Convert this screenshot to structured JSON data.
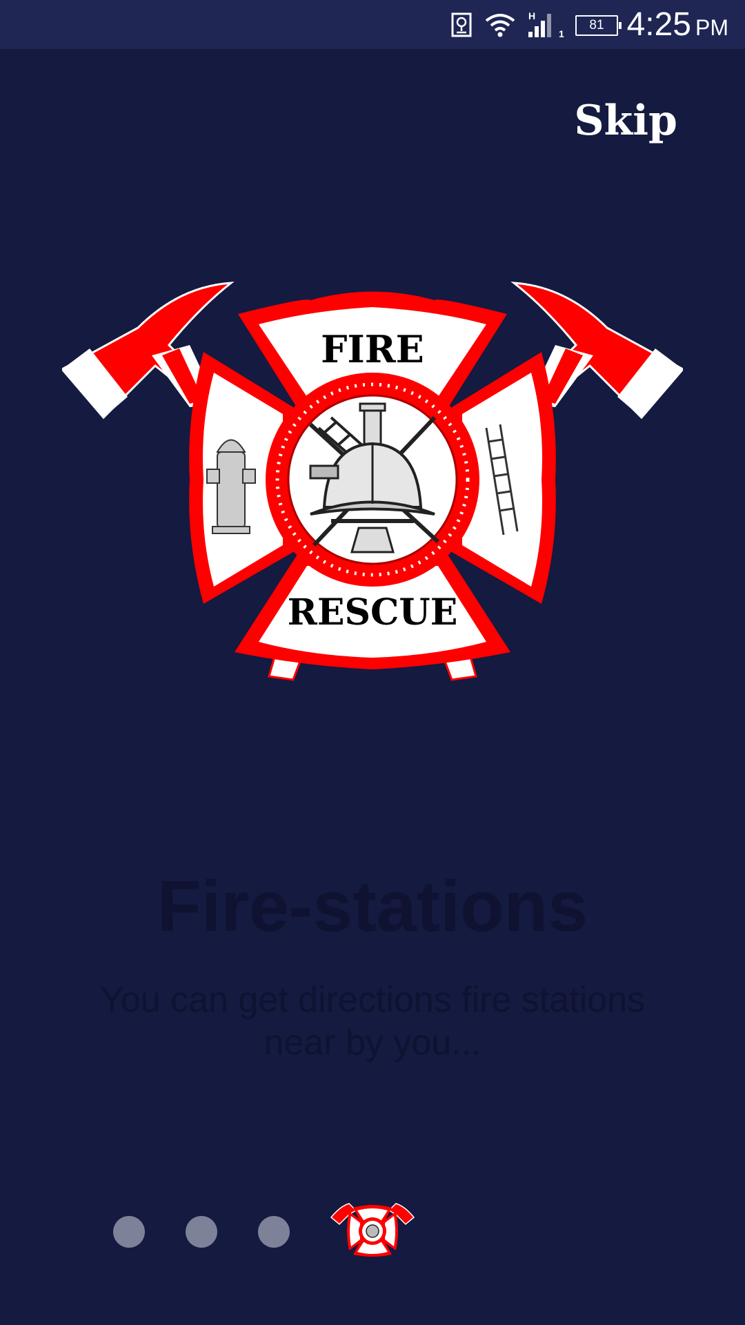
{
  "status_bar": {
    "time": "4:25",
    "ampm": "PM",
    "battery": "81",
    "network_type": "H",
    "sim_slot": "1",
    "icons": [
      "location-card-icon",
      "wifi-icon",
      "signal-icon",
      "battery-icon"
    ]
  },
  "onboarding": {
    "skip_label": "Skip",
    "title": "Fire-stations",
    "description": "You can get directions fire stations near by you...",
    "pages": [
      {
        "icon": "page-dot"
      },
      {
        "icon": "page-dot"
      },
      {
        "icon": "page-dot"
      },
      {
        "icon": "fire-rescue-emblem-icon",
        "active": true
      }
    ]
  },
  "emblem": {
    "top_text": "FIRE",
    "bottom_text": "RESCUE"
  },
  "colors": {
    "background": "#141a40",
    "status_bar": "#1f2654",
    "emblem_red": "#ff0000",
    "text_dark": "#0f1230",
    "inactive_dot": "#7e8299"
  }
}
